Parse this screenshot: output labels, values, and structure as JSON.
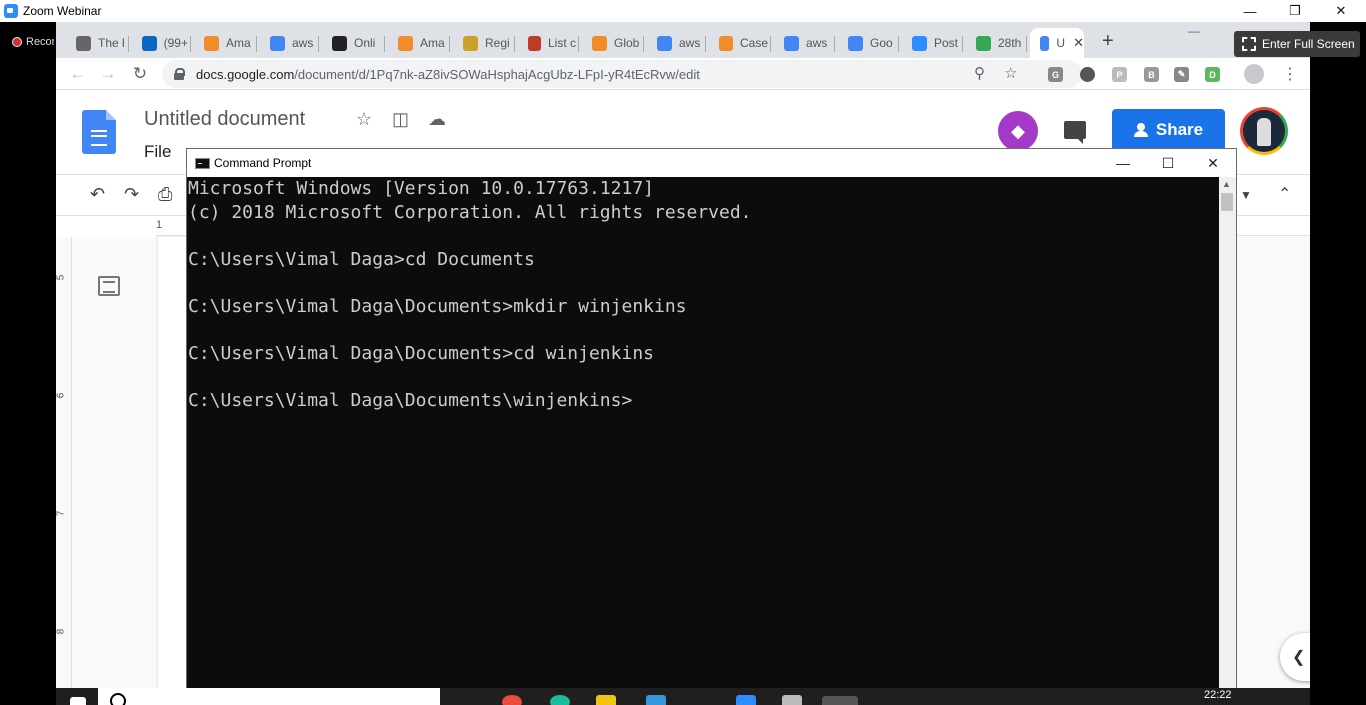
{
  "zoom": {
    "title": "Zoom Webinar",
    "recording_label": "Recording",
    "fullscreen_label": "Enter Full Screen"
  },
  "browser": {
    "tabs": [
      {
        "label": "The l",
        "icon": "globe-icon",
        "color": "#666666"
      },
      {
        "label": "(99+",
        "icon": "linkedin-icon",
        "color": "#0a66c2"
      },
      {
        "label": "Ama",
        "icon": "aws-cube-icon",
        "color": "#f28c28"
      },
      {
        "label": "aws",
        "icon": "google-icon",
        "color": "#4285f4"
      },
      {
        "label": "Onli",
        "icon": "amazon-icon",
        "color": "#222222"
      },
      {
        "label": "Ama",
        "icon": "aws-cube-icon",
        "color": "#f28c28"
      },
      {
        "label": "Regi",
        "icon": "book-icon",
        "color": "#c9a227"
      },
      {
        "label": "List c",
        "icon": "l-logo-icon",
        "color": "#c0392b"
      },
      {
        "label": "Glob",
        "icon": "aws-cube-icon",
        "color": "#f28c28"
      },
      {
        "label": "aws",
        "icon": "google-icon",
        "color": "#4285f4"
      },
      {
        "label": "Case",
        "icon": "aws-cube-icon",
        "color": "#f28c28"
      },
      {
        "label": "aws",
        "icon": "google-icon",
        "color": "#4285f4"
      },
      {
        "label": "Goo",
        "icon": "google-icon",
        "color": "#4285f4"
      },
      {
        "label": "Post",
        "icon": "zoom-icon",
        "color": "#2d8cff"
      },
      {
        "label": "28th",
        "icon": "drive-icon",
        "color": "#34a853"
      },
      {
        "label": "U",
        "icon": "docs-icon",
        "color": "#4285f4"
      }
    ],
    "url_host": "docs.google.com",
    "url_path": "/document/d/1Pq7nk-aZ8ivSOWaHsphajAcgUbz-LFpI-yR4tEcRvw/edit"
  },
  "docs": {
    "title": "Untitled document",
    "menu_file": "File",
    "share_label": "Share",
    "ruler_mark": "1",
    "vruler_marks": [
      "5",
      "6",
      "7",
      "8"
    ]
  },
  "cmd": {
    "window_title": "Command Prompt",
    "lines": [
      "Microsoft Windows [Version 10.0.17763.1217]",
      "(c) 2018 Microsoft Corporation. All rights reserved.",
      "",
      "C:\\Users\\Vimal Daga>cd Documents",
      "",
      "C:\\Users\\Vimal Daga\\Documents>mkdir winjenkins",
      "",
      "C:\\Users\\Vimal Daga\\Documents>cd winjenkins",
      "",
      "C:\\Users\\Vimal Daga\\Documents\\winjenkins>"
    ]
  },
  "taskbar": {
    "clock": "22:22"
  }
}
